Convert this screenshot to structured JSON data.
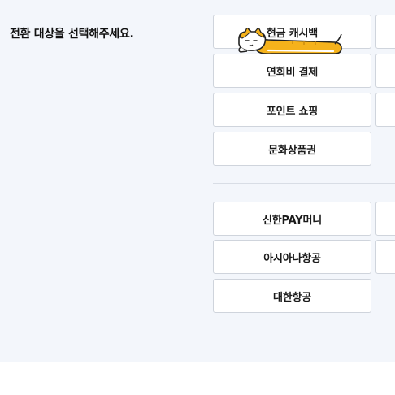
{
  "prompt": "전환 대상을 선택해주세요.",
  "group1": {
    "col1": [
      "현금 캐시백",
      "연회비 결제",
      "포인트 쇼핑",
      "문화상품권"
    ],
    "col2": [
      "",
      "",
      ""
    ]
  },
  "group2": {
    "col1": [
      "신한PAY머니",
      "아시아나항공",
      "대한항공"
    ],
    "col2": [
      "",
      ""
    ]
  },
  "mascot_icon": "orange-cat-icon",
  "colors": {
    "background": "#f3f6fb",
    "button_border": "#cfd4dc",
    "mascot": "#f5b21b"
  }
}
